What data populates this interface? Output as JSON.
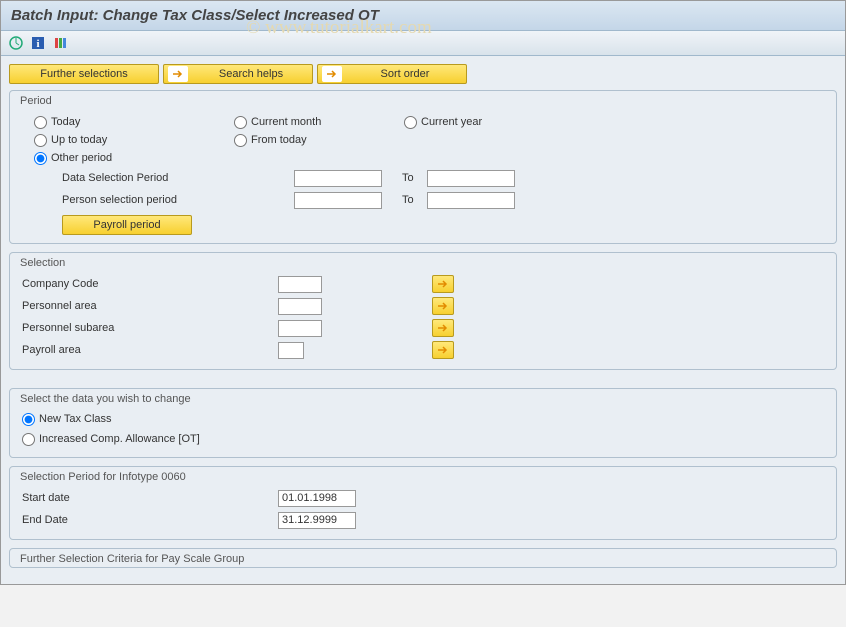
{
  "title": "Batch Input: Change Tax Class/Select Increased OT",
  "watermark": "©  www.tutorialkart.com",
  "buttons": {
    "further_selections": "Further selections",
    "search_helps": "Search helps",
    "sort_order": "Sort order",
    "payroll_period": "Payroll period"
  },
  "period": {
    "title": "Period",
    "opt_today": "Today",
    "opt_current_month": "Current month",
    "opt_current_year": "Current year",
    "opt_up_to_today": "Up to today",
    "opt_from_today": "From today",
    "opt_other_period": "Other period",
    "selected": "other",
    "data_sel_label": "Data Selection Period",
    "person_sel_label": "Person selection period",
    "to_label": "To",
    "data_from": "",
    "data_to": "",
    "person_from": "",
    "person_to": ""
  },
  "selection": {
    "title": "Selection",
    "company_code": {
      "label": "Company Code",
      "value": ""
    },
    "personnel_area": {
      "label": "Personnel area",
      "value": ""
    },
    "personnel_subarea": {
      "label": "Personnel subarea",
      "value": ""
    },
    "payroll_area": {
      "label": "Payroll area",
      "value": ""
    }
  },
  "change_data": {
    "title": "Select the data you wish to change",
    "opt_new_tax": "New Tax Class",
    "opt_increased": "Increased Comp. Allowance [OT]",
    "selected": "new_tax"
  },
  "infotype_period": {
    "title": "Selection Period for Infotype 0060",
    "start_label": "Start date",
    "end_label": "End Date",
    "start_value": "01.01.1998",
    "end_value": "31.12.9999"
  },
  "further_criteria": {
    "title": "Further Selection Criteria for Pay Scale Group"
  }
}
